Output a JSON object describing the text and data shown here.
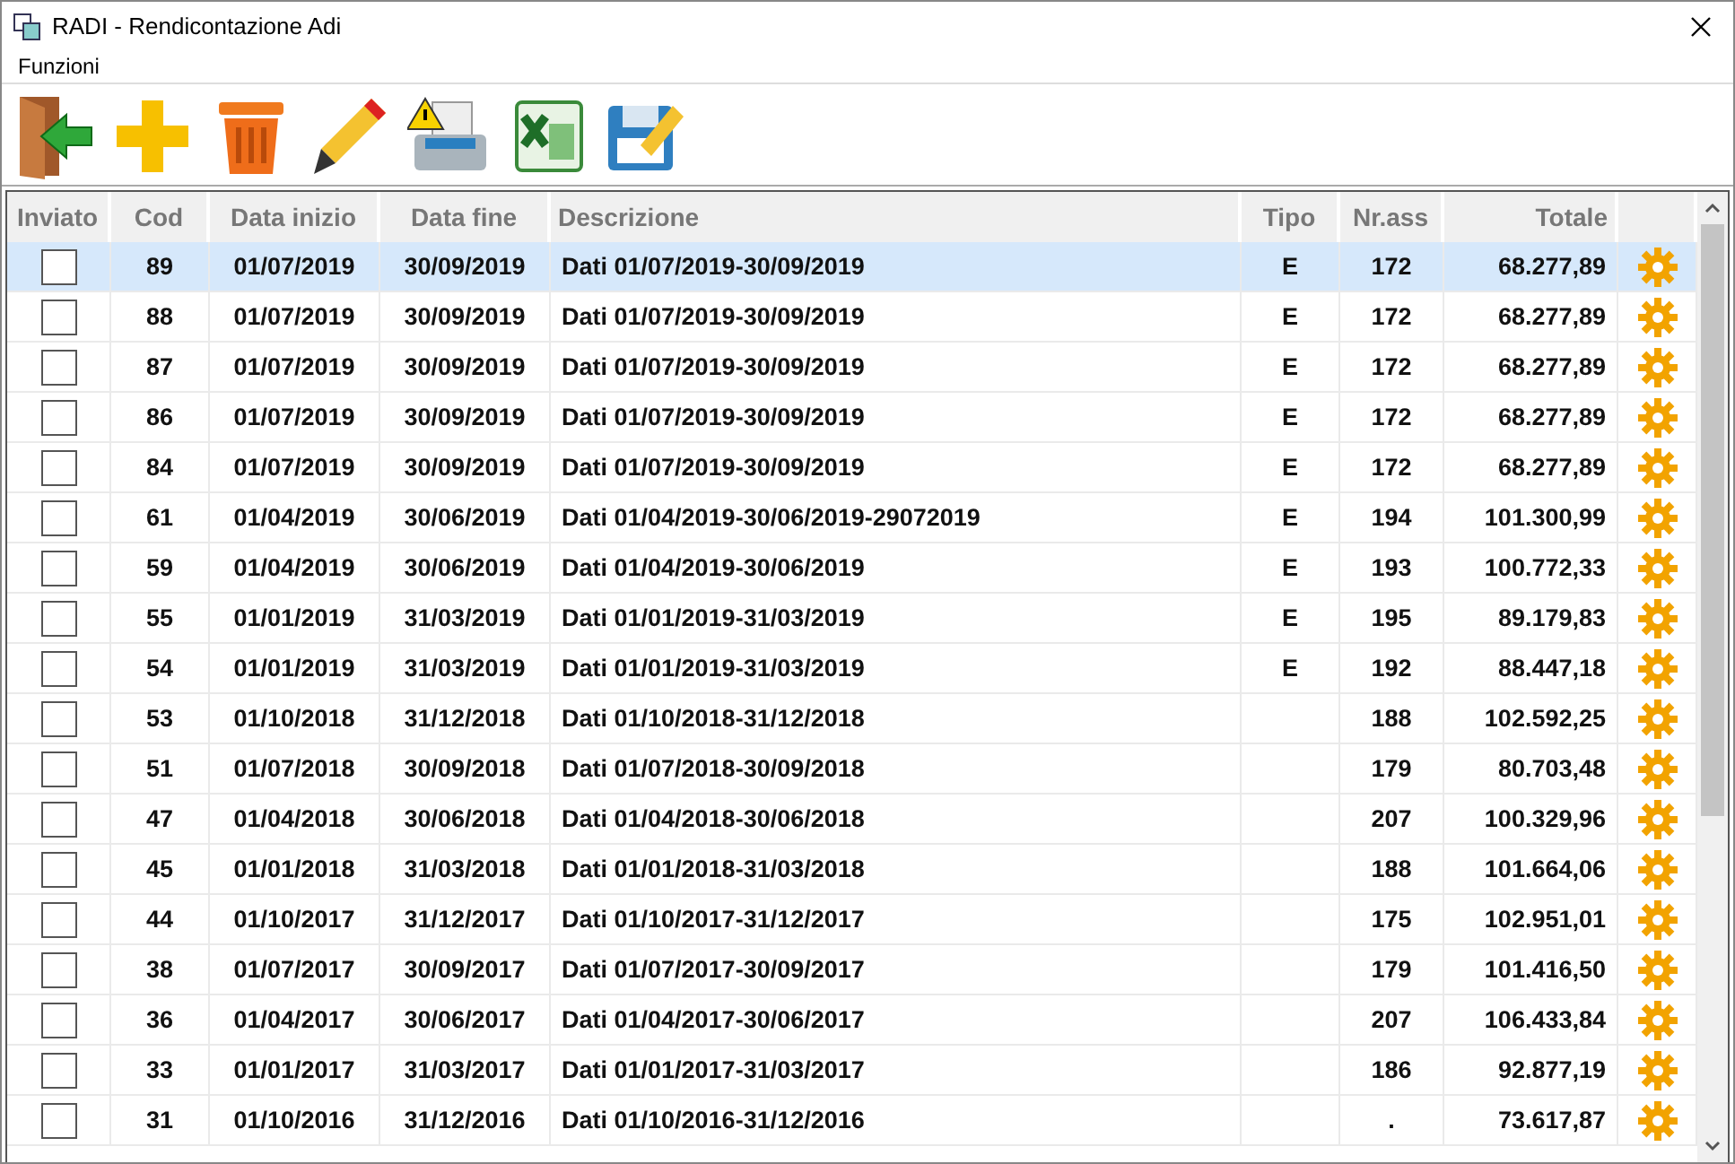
{
  "window": {
    "title": "RADI - Rendicontazione Adi"
  },
  "menu": [
    "Funzioni"
  ],
  "toolbar": [
    {
      "kind": "exit"
    },
    {
      "kind": "add"
    },
    {
      "kind": "delete"
    },
    {
      "kind": "edit"
    },
    {
      "kind": "print"
    },
    {
      "kind": "excel"
    },
    {
      "kind": "save"
    }
  ],
  "table": {
    "columns": [
      "Inviato",
      "Cod",
      "Data inizio",
      "Data fine",
      "Descrizione",
      "Tipo",
      "Nr.ass",
      "Totale"
    ],
    "rows": [
      {
        "selected": true,
        "checked": false,
        "cod": "89",
        "data_inizio": "01/07/2019",
        "data_fine": "30/09/2019",
        "descrizione": "Dati 01/07/2019-30/09/2019",
        "tipo": "E",
        "nr_ass": "172",
        "totale": "68.277,89"
      },
      {
        "selected": false,
        "checked": false,
        "cod": "88",
        "data_inizio": "01/07/2019",
        "data_fine": "30/09/2019",
        "descrizione": "Dati 01/07/2019-30/09/2019",
        "tipo": "E",
        "nr_ass": "172",
        "totale": "68.277,89"
      },
      {
        "selected": false,
        "checked": false,
        "cod": "87",
        "data_inizio": "01/07/2019",
        "data_fine": "30/09/2019",
        "descrizione": "Dati 01/07/2019-30/09/2019",
        "tipo": "E",
        "nr_ass": "172",
        "totale": "68.277,89"
      },
      {
        "selected": false,
        "checked": false,
        "cod": "86",
        "data_inizio": "01/07/2019",
        "data_fine": "30/09/2019",
        "descrizione": "Dati 01/07/2019-30/09/2019",
        "tipo": "E",
        "nr_ass": "172",
        "totale": "68.277,89"
      },
      {
        "selected": false,
        "checked": false,
        "cod": "84",
        "data_inizio": "01/07/2019",
        "data_fine": "30/09/2019",
        "descrizione": "Dati 01/07/2019-30/09/2019",
        "tipo": "E",
        "nr_ass": "172",
        "totale": "68.277,89"
      },
      {
        "selected": false,
        "checked": false,
        "cod": "61",
        "data_inizio": "01/04/2019",
        "data_fine": "30/06/2019",
        "descrizione": "Dati 01/04/2019-30/06/2019-29072019",
        "tipo": "E",
        "nr_ass": "194",
        "totale": "101.300,99"
      },
      {
        "selected": false,
        "checked": false,
        "cod": "59",
        "data_inizio": "01/04/2019",
        "data_fine": "30/06/2019",
        "descrizione": "Dati 01/04/2019-30/06/2019",
        "tipo": "E",
        "nr_ass": "193",
        "totale": "100.772,33"
      },
      {
        "selected": false,
        "checked": false,
        "cod": "55",
        "data_inizio": "01/01/2019",
        "data_fine": "31/03/2019",
        "descrizione": "Dati 01/01/2019-31/03/2019",
        "tipo": "E",
        "nr_ass": "195",
        "totale": "89.179,83"
      },
      {
        "selected": false,
        "checked": false,
        "cod": "54",
        "data_inizio": "01/01/2019",
        "data_fine": "31/03/2019",
        "descrizione": "Dati 01/01/2019-31/03/2019",
        "tipo": "E",
        "nr_ass": "192",
        "totale": "88.447,18"
      },
      {
        "selected": false,
        "checked": false,
        "cod": "53",
        "data_inizio": "01/10/2018",
        "data_fine": "31/12/2018",
        "descrizione": "Dati 01/10/2018-31/12/2018",
        "nr_ass": "188",
        "totale": "102.592,25"
      },
      {
        "selected": false,
        "checked": false,
        "cod": "51",
        "data_inizio": "01/07/2018",
        "data_fine": "30/09/2018",
        "descrizione": "Dati 01/07/2018-30/09/2018",
        "nr_ass": "179",
        "totale": "80.703,48"
      },
      {
        "selected": false,
        "checked": false,
        "cod": "47",
        "data_inizio": "01/04/2018",
        "data_fine": "30/06/2018",
        "descrizione": "Dati 01/04/2018-30/06/2018",
        "nr_ass": "207",
        "totale": "100.329,96"
      },
      {
        "selected": false,
        "checked": false,
        "cod": "45",
        "data_inizio": "01/01/2018",
        "data_fine": "31/03/2018",
        "descrizione": "Dati 01/01/2018-31/03/2018",
        "nr_ass": "188",
        "totale": "101.664,06"
      },
      {
        "selected": false,
        "checked": false,
        "cod": "44",
        "data_inizio": "01/10/2017",
        "data_fine": "31/12/2017",
        "descrizione": "Dati 01/10/2017-31/12/2017",
        "nr_ass": "175",
        "totale": "102.951,01"
      },
      {
        "selected": false,
        "checked": false,
        "cod": "38",
        "data_inizio": "01/07/2017",
        "data_fine": "30/09/2017",
        "descrizione": "Dati 01/07/2017-30/09/2017",
        "nr_ass": "179",
        "totale": "101.416,50"
      },
      {
        "selected": false,
        "checked": false,
        "cod": "36",
        "data_inizio": "01/04/2017",
        "data_fine": "30/06/2017",
        "descrizione": "Dati 01/04/2017-30/06/2017",
        "nr_ass": "207",
        "totale": "106.433,84"
      },
      {
        "selected": false,
        "checked": false,
        "cod": "33",
        "data_inizio": "01/01/2017",
        "data_fine": "31/03/2017",
        "descrizione": "Dati 01/01/2017-31/03/2017",
        "nr_ass": "186",
        "totale": "92.877,19"
      },
      {
        "selected": false,
        "checked": false,
        "cod": "31",
        "data_inizio": "01/10/2016",
        "data_fine": "31/12/2016",
        "descrizione": "Dati 01/10/2016-31/12/2016",
        "nr_ass": ".",
        "totale": "73.617,87"
      }
    ]
  }
}
